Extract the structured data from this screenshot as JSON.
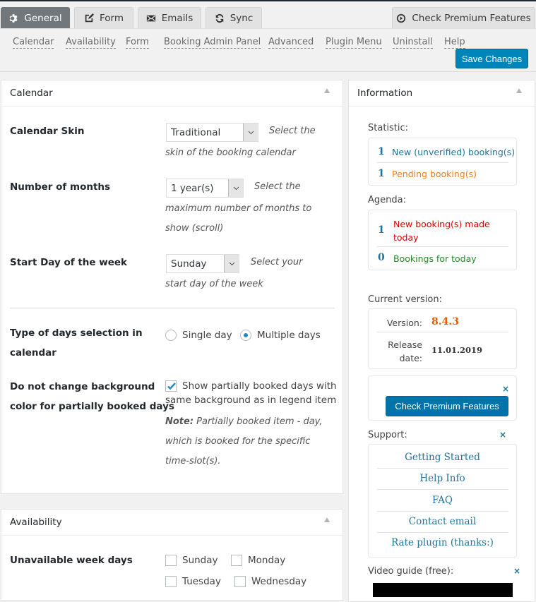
{
  "tabs": [
    {
      "label": "General",
      "icon": "gear-icon",
      "active": true
    },
    {
      "label": "Form",
      "icon": "edit-icon",
      "active": false
    },
    {
      "label": "Emails",
      "icon": "envelope-icon",
      "active": false
    },
    {
      "label": "Sync",
      "icon": "sync-icon",
      "active": false
    }
  ],
  "premium_tab": {
    "label": "Check Premium Features",
    "icon": "play-circle-icon"
  },
  "subnav": [
    "Calendar",
    "Availability",
    "Form",
    "Booking Admin Panel",
    "Advanced",
    "Plugin Menu",
    "Uninstall",
    "Help"
  ],
  "save_label": "Save Changes",
  "calendar": {
    "title": "Calendar",
    "skin": {
      "label": "Calendar Skin",
      "value": "Traditional",
      "desc1": "Select the",
      "desc2": "skin of the booking calendar"
    },
    "months": {
      "label": "Number of months",
      "value": "1 year(s)",
      "desc1": "Select the",
      "desc2": "maximum number of months to",
      "desc3": "show (scroll)"
    },
    "start_day": {
      "label": "Start Day of the week",
      "value": "Sunday",
      "desc1": "Select your",
      "desc2": "start day of the week"
    },
    "days_selection": {
      "label1": "Type of days selection in",
      "label2": "calendar",
      "options": [
        "Single day",
        "Multiple days"
      ],
      "selected": "Multiple days"
    },
    "partial": {
      "label1": "Do not change background",
      "label2": "color for partially booked days",
      "checkbox_line1": "Show partially booked days with",
      "checkbox_line2": "same background as in legend item",
      "checked": true,
      "note_bold": "Note:",
      "note1": " Partially booked item - day,",
      "note2": "which is booked for the specific",
      "note3": "time-slot(s)."
    }
  },
  "availability": {
    "title": "Availability",
    "label": "Unavailable week days",
    "days": [
      "Sunday",
      "Monday",
      "Tuesday",
      "Wednesday"
    ]
  },
  "info": {
    "title": "Information",
    "statistic_label": "Statistic:",
    "stats": [
      {
        "count": "1",
        "text": "New (unverified) booking(s)",
        "color": "#21759b"
      },
      {
        "count": "1",
        "text": "Pending booking(s)",
        "color": "#e67e22"
      }
    ],
    "agenda_label": "Agenda:",
    "agenda": [
      {
        "count": "1",
        "text1": "New booking(s) made",
        "text2": "today",
        "color": "#dd0000"
      },
      {
        "count": "0",
        "text1": "Bookings for today",
        "color": "#228b22"
      }
    ],
    "version_label": "Current version:",
    "version_key": "Version:",
    "version_value": "8.4.3",
    "release_key1": "Release",
    "release_key2": "date:",
    "release_value": "11.01.2019",
    "premium_button": "Check Premium Features",
    "close_glyph": "×",
    "support_label": "Support:",
    "support_links": [
      "Getting Started",
      "Help Info",
      "FAQ",
      "Contact email",
      "Rate plugin (thanks:)"
    ],
    "video_label": "Video guide (free):"
  }
}
